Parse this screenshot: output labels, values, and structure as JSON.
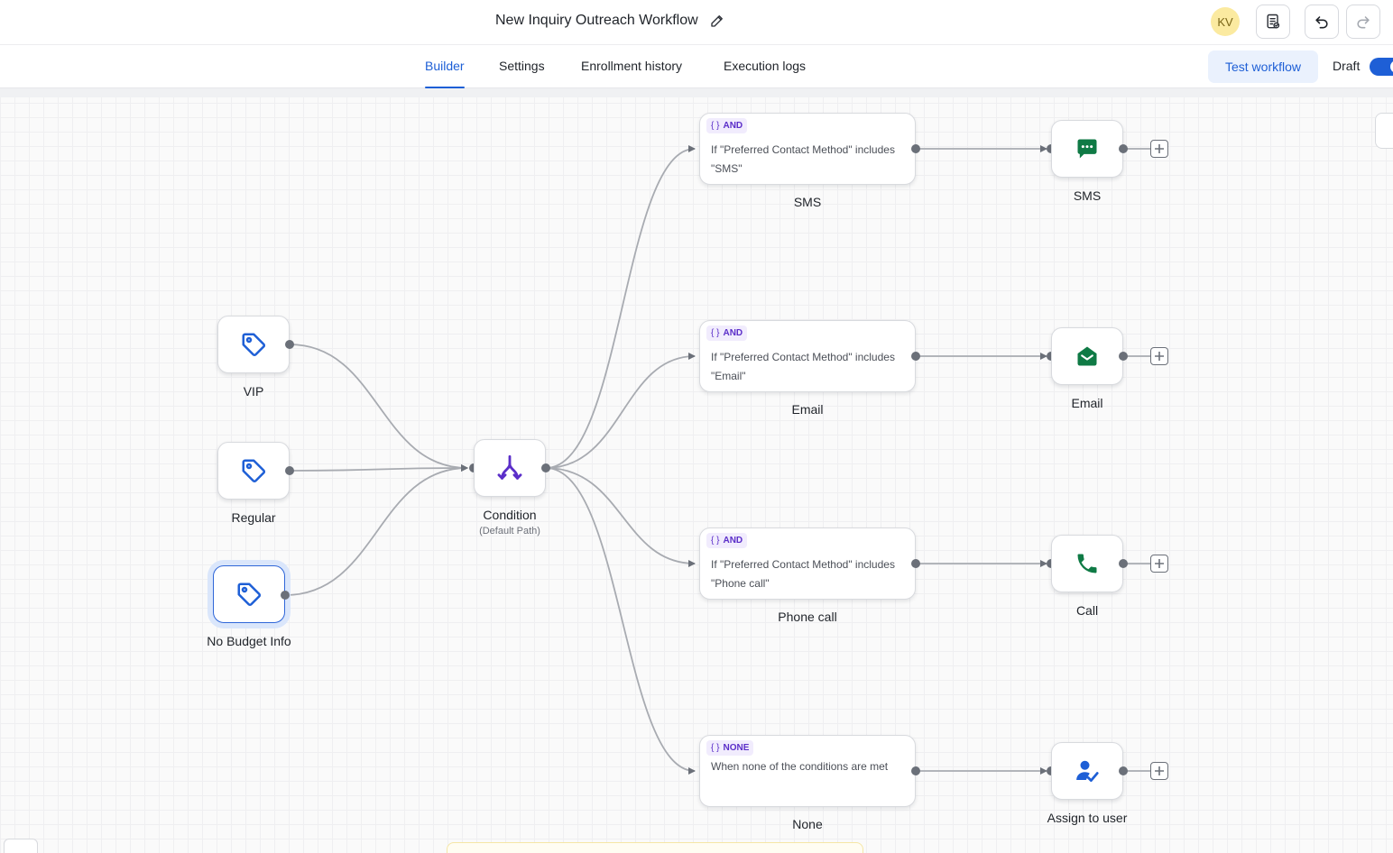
{
  "header": {
    "title": "New Inquiry Outreach Workflow",
    "avatar_initials": "KV"
  },
  "tabs": [
    {
      "label": "Builder",
      "active": true
    },
    {
      "label": "Settings",
      "active": false
    },
    {
      "label": "Enrollment history",
      "active": false
    },
    {
      "label": "Execution logs",
      "active": false
    }
  ],
  "toolbar": {
    "test_label": "Test workflow",
    "status_label": "Draft",
    "status_toggle_on": true
  },
  "triggers": [
    {
      "label": "VIP"
    },
    {
      "label": "Regular"
    },
    {
      "label": "No Budget Info",
      "selected": true
    }
  ],
  "condition": {
    "label": "Condition",
    "sublabel": "(Default Path)"
  },
  "branches": [
    {
      "badge": "AND",
      "text_line1": "If \"Preferred Contact Method\" includes",
      "text_line2": "\"SMS\"",
      "label": "SMS",
      "action": {
        "label": "SMS",
        "icon": "sms-icon"
      }
    },
    {
      "badge": "AND",
      "text_line1": "If \"Preferred Contact Method\" includes",
      "text_line2": "\"Email\"",
      "label": "Email",
      "action": {
        "label": "Email",
        "icon": "email-icon"
      }
    },
    {
      "badge": "AND",
      "text_line1": "If \"Preferred Contact Method\" includes",
      "text_line2": "\"Phone call\"",
      "label": "Phone call",
      "action": {
        "label": "Call",
        "icon": "phone-icon"
      }
    },
    {
      "badge": "NONE",
      "text_line1": "When none of the conditions are met",
      "text_line2": "",
      "label": "None",
      "action": {
        "label": "Assign to user",
        "icon": "assign-user-icon"
      }
    }
  ],
  "colors": {
    "accent": "#1e5fd6",
    "action_green": "#0f7a45",
    "condition_purple": "#5b2ec9",
    "tag_blue": "#1e5fd6",
    "assign_blue": "#1e5fd6"
  }
}
